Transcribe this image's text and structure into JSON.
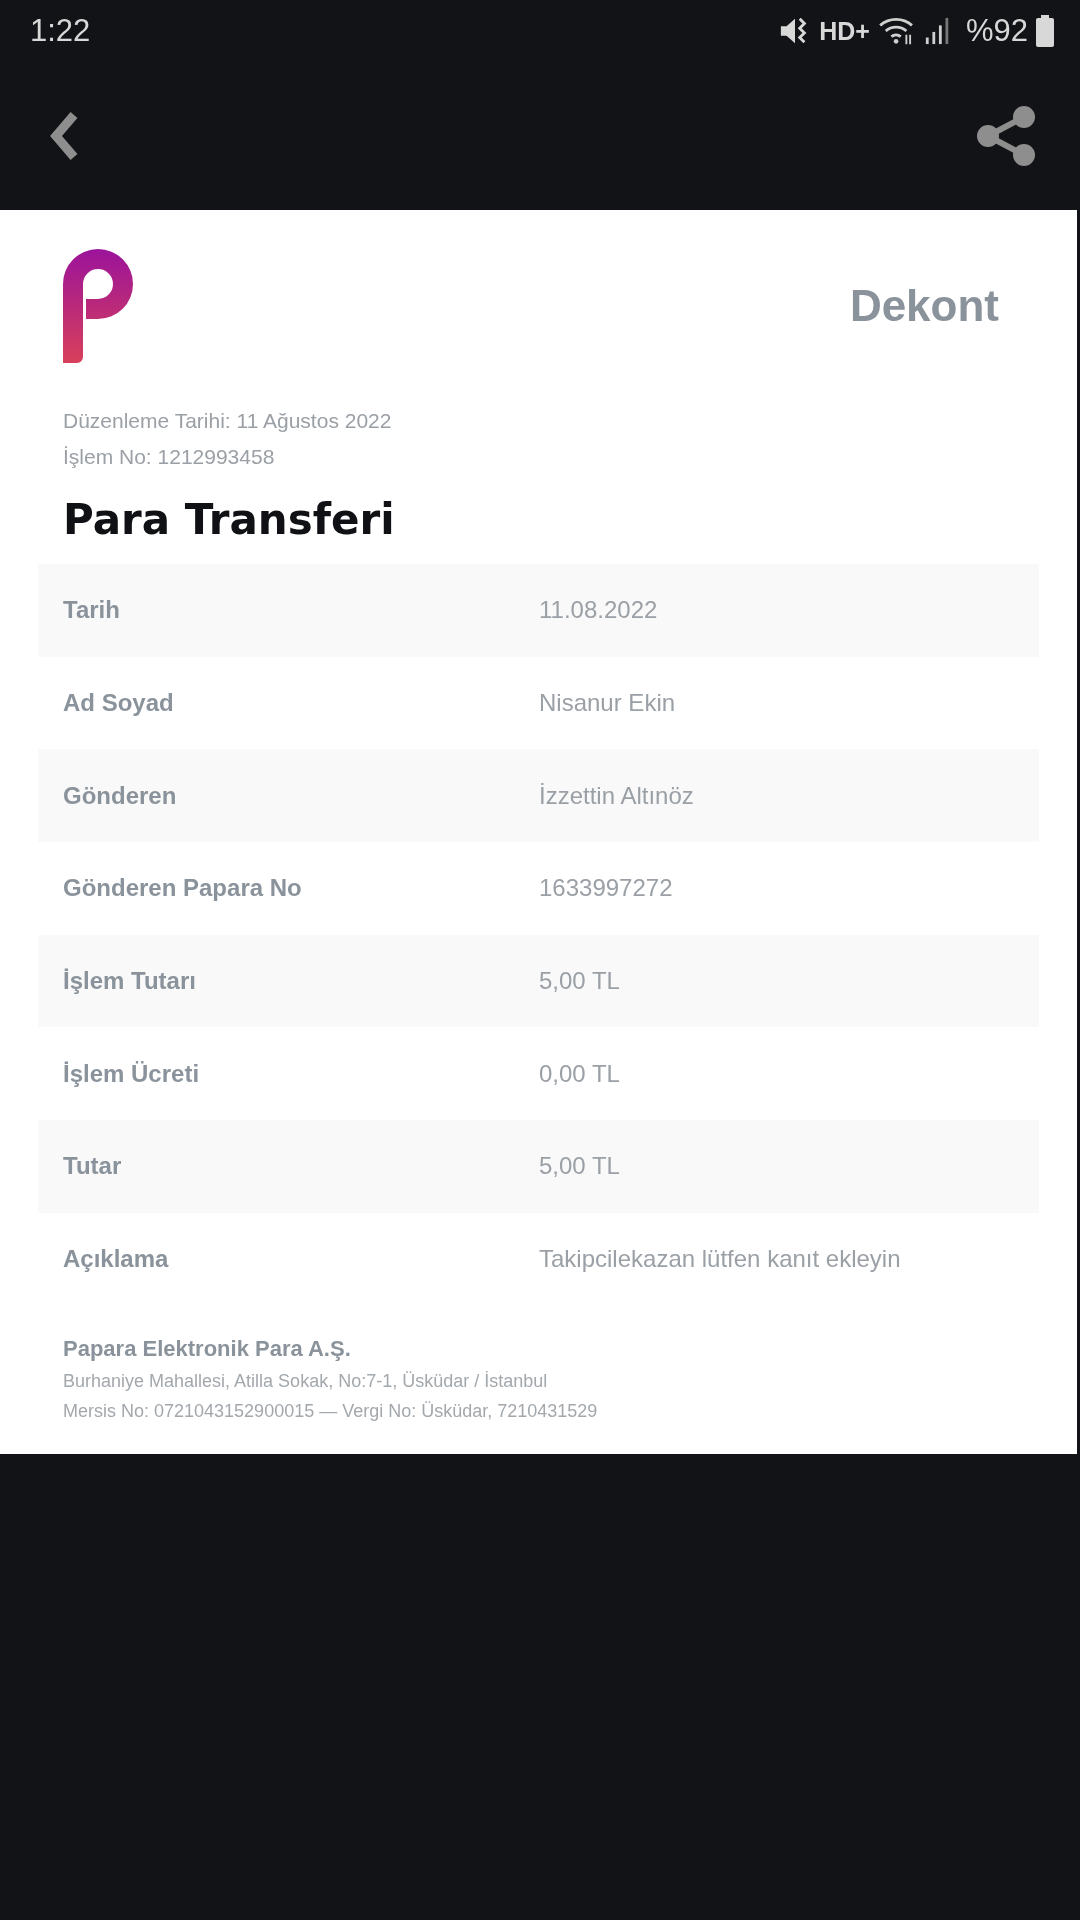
{
  "status_bar": {
    "time": "1:22",
    "network": "HD+",
    "battery": "%92"
  },
  "document": {
    "title": "Dekont",
    "issue_date": "Düzenleme Tarihi: 11 Ağustos 2022",
    "transaction_no": "İşlem No: 1212993458",
    "heading": "Para Transferi",
    "rows": [
      {
        "label": "Tarih",
        "value": "11.08.2022"
      },
      {
        "label": "Ad Soyad",
        "value": "Nisanur Ekin"
      },
      {
        "label": "Gönderen",
        "value": "İzzettin Altınöz"
      },
      {
        "label": "Gönderen Papara No",
        "value": "1633997272"
      },
      {
        "label": "İşlem Tutarı",
        "value": "5,00 TL"
      },
      {
        "label": "İşlem Ücreti",
        "value": "0,00 TL"
      },
      {
        "label": "Tutar",
        "value": "5,00 TL"
      },
      {
        "label": "Açıklama",
        "value": "Takipcilekazan lütfen kanıt ekleyin"
      }
    ],
    "footer": {
      "company": "Papara Elektronik Para A.Ş.",
      "address": "Burhaniye Mahallesi, Atilla Sokak, No:7-1, Üsküdar / İstanbul",
      "registry": "Mersis No: 0721043152900015 — Vergi No: Üsküdar, 7210431529"
    }
  }
}
